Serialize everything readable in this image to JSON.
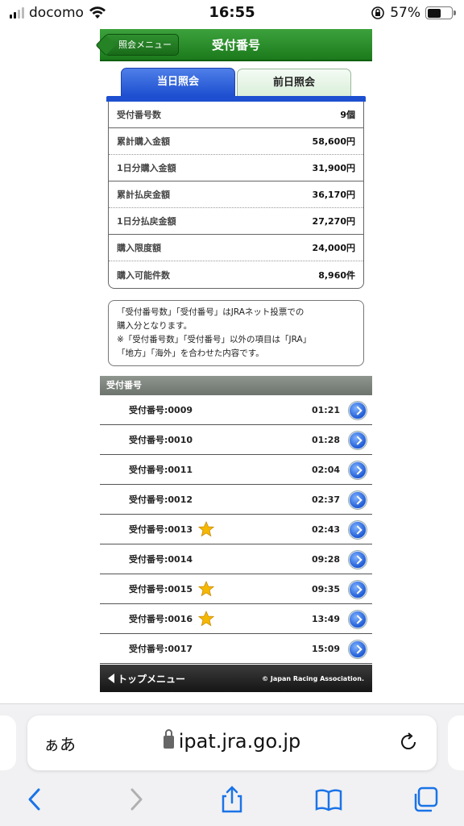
{
  "status_bar": {
    "carrier": "docomo",
    "time": "16:55",
    "battery": "57%"
  },
  "header": {
    "back_label": "照会メニュー",
    "title": "受付番号"
  },
  "tabs": {
    "active": "当日照会",
    "inactive": "前日照会"
  },
  "summary": [
    {
      "label": "受付番号数",
      "value": "9個"
    },
    {
      "label": "累計購入金額",
      "value": "58,600円"
    },
    {
      "label": "1日分購入金額",
      "value": "31,900円"
    },
    {
      "label": "累計払戻金額",
      "value": "36,170円"
    },
    {
      "label": "1日分払戻金額",
      "value": "27,270円"
    },
    {
      "label": "購入限度額",
      "value": "24,000円"
    },
    {
      "label": "購入可能件数",
      "value": "8,960件"
    }
  ],
  "note": {
    "line1": "「受付番号数」「受付番号」はJRAネット投票での",
    "line2": "購入分となります。",
    "line3": "※「受付番号数」「受付番号」以外の項目は「JRA」",
    "line4": "「地方」「海外」を合わせた内容です。"
  },
  "list_header": "受付番号",
  "list": [
    {
      "label": "受付番号:0009",
      "time": "01:21",
      "star": false
    },
    {
      "label": "受付番号:0010",
      "time": "01:28",
      "star": false
    },
    {
      "label": "受付番号:0011",
      "time": "02:04",
      "star": false
    },
    {
      "label": "受付番号:0012",
      "time": "02:37",
      "star": false
    },
    {
      "label": "受付番号:0013",
      "time": "02:43",
      "star": true
    },
    {
      "label": "受付番号:0014",
      "time": "09:28",
      "star": false
    },
    {
      "label": "受付番号:0015",
      "time": "09:35",
      "star": true
    },
    {
      "label": "受付番号:0016",
      "time": "13:49",
      "star": true
    },
    {
      "label": "受付番号:0017",
      "time": "15:09",
      "star": false
    }
  ],
  "footer": {
    "top_menu": "トップメニュー",
    "copyright": "© Japan Racing Association."
  },
  "browser": {
    "aa_label": "ぁあ",
    "url": "ipat.jra.go.jp"
  },
  "colors": {
    "header_green": "#1c7a1c",
    "tab_blue": "#1d4fd0",
    "star_gold": "#f5b800"
  }
}
